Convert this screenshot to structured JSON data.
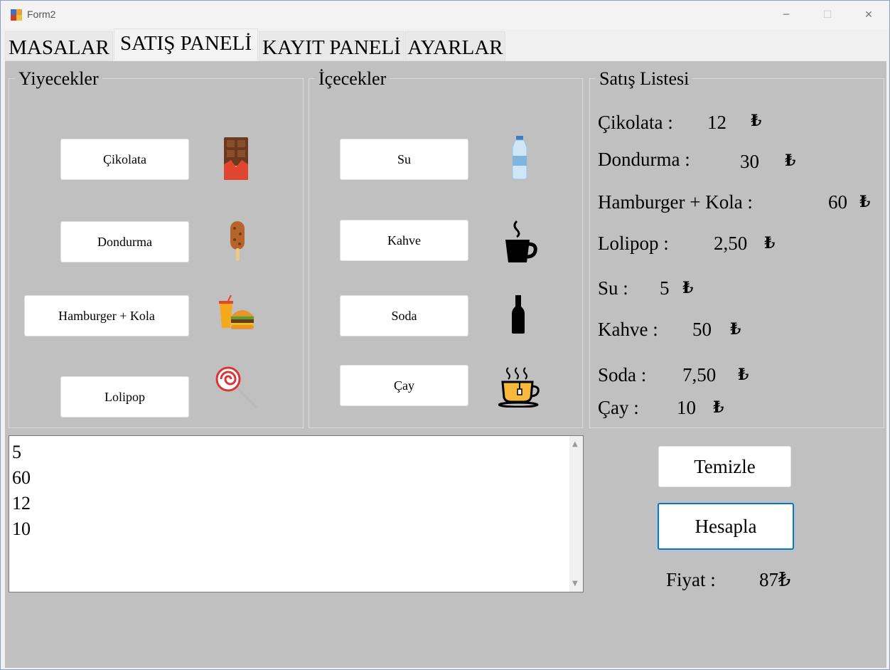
{
  "window": {
    "title": "Form2"
  },
  "tabs": [
    {
      "label": "MASALAR"
    },
    {
      "label": "SATIŞ PANELİ"
    },
    {
      "label": "KAYIT PANELİ"
    },
    {
      "label": "AYARLAR"
    }
  ],
  "food": {
    "title": "Yiyecekler",
    "items": [
      {
        "label": "Çikolata"
      },
      {
        "label": "Dondurma"
      },
      {
        "label": "Hamburger + Kola"
      },
      {
        "label": "Lolipop"
      }
    ]
  },
  "drinks": {
    "title": "İçecekler",
    "items": [
      {
        "label": "Su"
      },
      {
        "label": "Kahve"
      },
      {
        "label": "Soda"
      },
      {
        "label": "Çay"
      }
    ]
  },
  "price_list": {
    "title": "Satış Listesi",
    "currency": "₺",
    "items": [
      {
        "name": "Çikolata :",
        "price": "12"
      },
      {
        "name": "Dondurma :",
        "price": "30"
      },
      {
        "name": "Hamburger + Kola :",
        "price": "60"
      },
      {
        "name": "Lolipop :",
        "price": "2,50"
      },
      {
        "name": "Su :",
        "price": "5"
      },
      {
        "name": "Kahve :",
        "price": "50"
      },
      {
        "name": "Soda :",
        "price": "7,50"
      },
      {
        "name": "Çay :",
        "price": "10"
      }
    ]
  },
  "sales_list": {
    "items": [
      " 5",
      "60",
      "12",
      "10"
    ]
  },
  "actions": {
    "clear": "Temizle",
    "calculate": "Hesapla"
  },
  "total": {
    "label": "Fiyat :",
    "value": "87₺"
  }
}
